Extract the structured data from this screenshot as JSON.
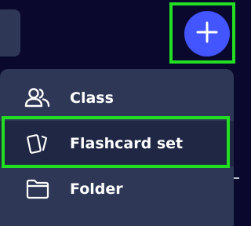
{
  "create_button": {
    "icon": "plus-icon",
    "color": "#4255ff"
  },
  "menu": {
    "items": [
      {
        "label": "Class",
        "icon": "users-icon"
      },
      {
        "label": "Flashcard set",
        "icon": "flashcards-icon",
        "highlighted": true
      },
      {
        "label": "Folder",
        "icon": "folder-icon"
      }
    ]
  },
  "colors": {
    "background": "#0a092d",
    "menu_background": "#2e3856",
    "highlight": "#22dd22",
    "accent": "#4255ff"
  }
}
